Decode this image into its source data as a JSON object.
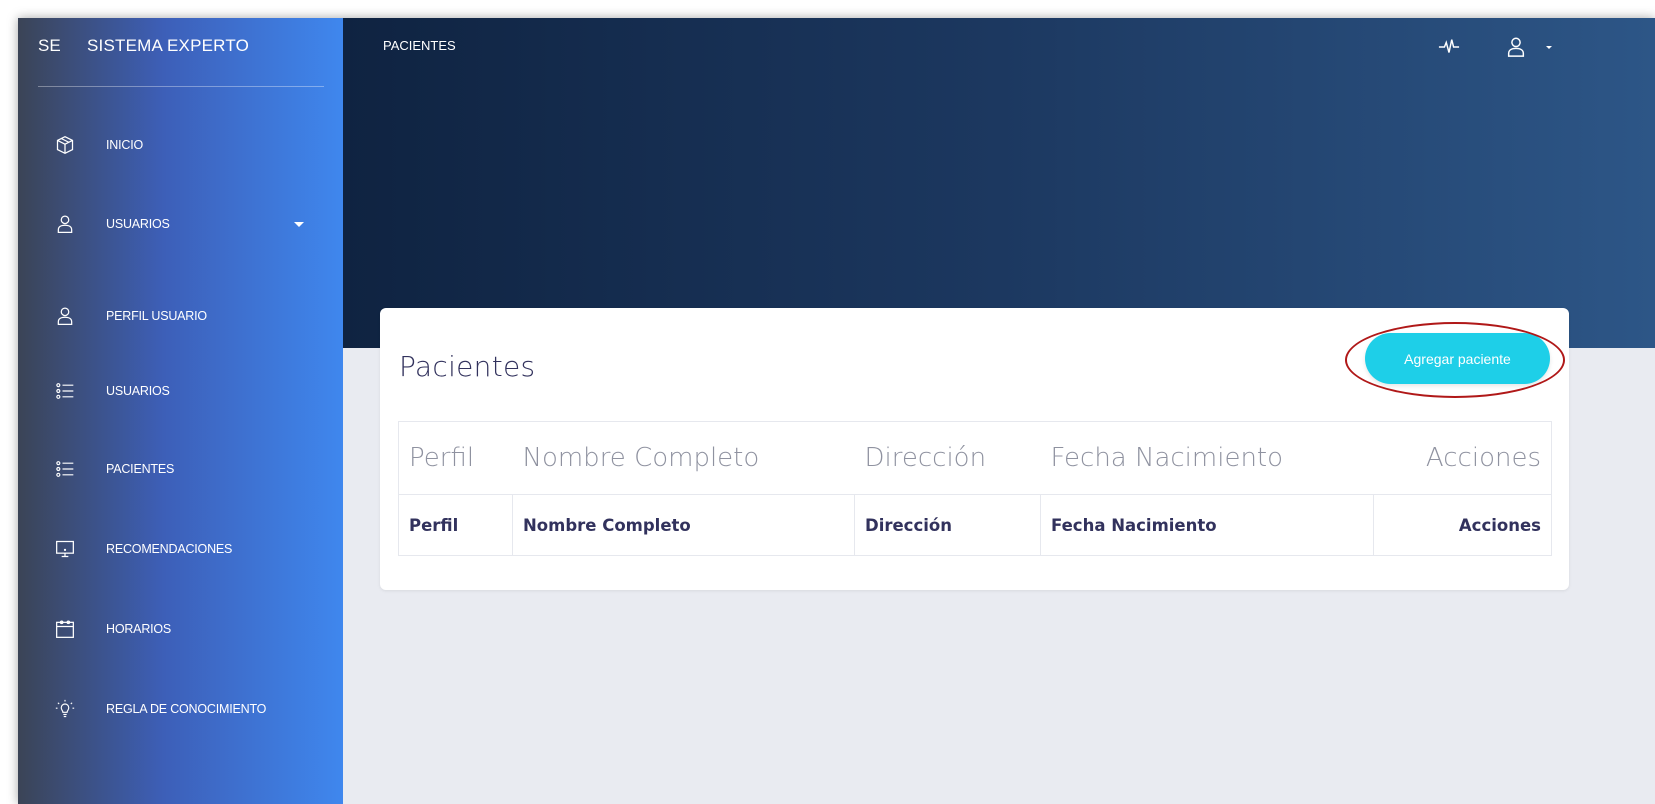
{
  "sidebar": {
    "brand_short": "SE",
    "brand_name": "SISTEMA EXPERTO",
    "items": [
      {
        "label": "INICIO",
        "icon": "box-icon"
      },
      {
        "label": "USUARIOS",
        "icon": "user-icon",
        "has_caret": true
      },
      {
        "label": "PERFIL USUARIO",
        "icon": "user-icon"
      },
      {
        "label": "USUARIOS",
        "icon": "list-icon"
      },
      {
        "label": "PACIENTES",
        "icon": "list-icon"
      },
      {
        "label": "RECOMENDACIONES",
        "icon": "monitor-icon"
      },
      {
        "label": "HORARIOS",
        "icon": "calendar-icon"
      },
      {
        "label": "REGLA DE CONOCIMIENTO",
        "icon": "lightbulb-icon"
      }
    ]
  },
  "header": {
    "title": "PACIENTES",
    "icons": [
      "activity-icon",
      "user-icon"
    ]
  },
  "card": {
    "title": "Pacientes",
    "add_button_label": "Agregar paciente",
    "table": {
      "columns": [
        "Perfil",
        "Nombre Completo",
        "Dirección",
        "Fecha Nacimiento",
        "Acciones"
      ],
      "footer": [
        "Perfil",
        "Nombre Completo",
        "Dirección",
        "Fecha Nacimiento",
        "Acciones"
      ]
    }
  },
  "colors": {
    "accent": "#1ecfe8",
    "highlight": "#b01818",
    "header_dark": "#0f2341",
    "sidebar_blue": "#3f87ee"
  }
}
